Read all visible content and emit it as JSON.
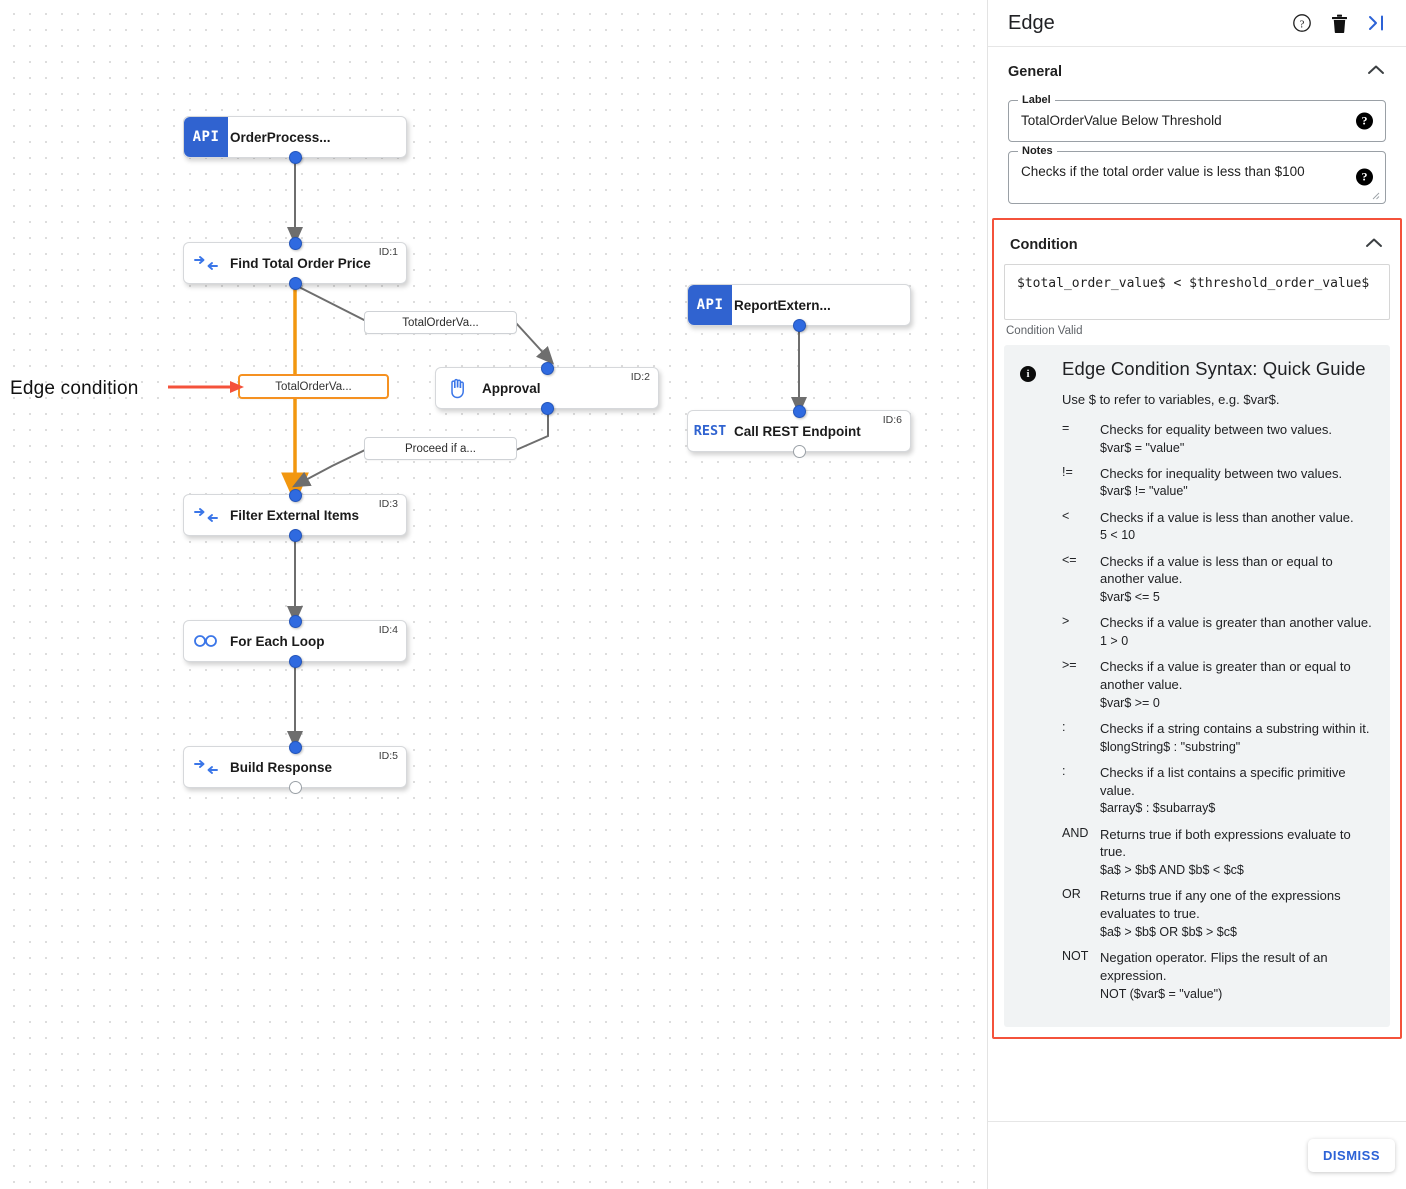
{
  "panel": {
    "title": "Edge",
    "icons": [
      {
        "name": "help-icon",
        "glyph": "?"
      },
      {
        "name": "delete-icon",
        "glyph": "trash"
      },
      {
        "name": "collapse-panel-icon",
        "glyph": ">|"
      }
    ],
    "general": {
      "section_title": "General",
      "label_legend": "Label",
      "label_value": "TotalOrderValue Below Threshold",
      "notes_legend": "Notes",
      "notes_value": "Checks if the total order value is less than $100"
    },
    "condition": {
      "section_title": "Condition",
      "expression": "$total_order_value$ < $threshold_order_value$",
      "status": "Condition Valid",
      "highlight_color": "#f4523b",
      "guide": {
        "title": "Edge Condition Syntax: Quick Guide",
        "intro": "Use $ to refer to variables, e.g. $var$.",
        "operators": [
          {
            "symbol": "=",
            "description": "Checks for equality between two values.",
            "example": "$var$ = \"value\""
          },
          {
            "symbol": "!=",
            "description": "Checks for inequality between two values.",
            "example": "$var$ != \"value\""
          },
          {
            "symbol": "<",
            "description": "Checks if a value is less than another value.",
            "example": "5 < 10"
          },
          {
            "symbol": "<=",
            "description": "Checks if a value is less than or equal to another value.",
            "example": "$var$ <= 5"
          },
          {
            "symbol": ">",
            "description": "Checks if a value is greater than another value.",
            "example": "1 > 0"
          },
          {
            "symbol": ">=",
            "description": "Checks if a value is greater than or equal to another value.",
            "example": "$var$ >= 0"
          },
          {
            "symbol": ":",
            "description": "Checks if a string contains a substring within it.",
            "example": "$longString$ : \"substring\""
          },
          {
            "symbol": ":",
            "description": "Checks if a list contains a specific primitive value.",
            "example": "$array$ : $subarray$"
          },
          {
            "symbol": "AND",
            "description": "Returns true if both expressions evaluate to true.",
            "example": "$a$ > $b$ AND $b$ < $c$"
          },
          {
            "symbol": "OR",
            "description": "Returns true if any one of the expressions evaluates to true.",
            "example": "$a$ > $b$ OR $b$ > $c$"
          },
          {
            "symbol": "NOT",
            "description": "Negation operator. Flips the result of an expression.",
            "example": "NOT ($var$ = \"value\")"
          }
        ]
      }
    },
    "footer": {
      "dismiss_label": "DISMISS"
    }
  },
  "canvas": {
    "annotation": {
      "text": "Edge condition",
      "arrow_color": "#f4523b"
    },
    "accent_edge_color": "#f2970f",
    "nodes": [
      {
        "title": "OrderProcess...",
        "id_label": "",
        "icon": "api-badge",
        "badge": "API"
      },
      {
        "title": "Find Total Order Price",
        "id_label": "ID:1",
        "icon": "converge-arrows-icon"
      },
      {
        "title": "Approval",
        "id_label": "ID:2",
        "icon": "hand-icon"
      },
      {
        "title": "Filter External Items",
        "id_label": "ID:3",
        "icon": "converge-arrows-icon"
      },
      {
        "title": "For Each Loop",
        "id_label": "ID:4",
        "icon": "loop-infinity-icon"
      },
      {
        "title": "Build Response",
        "id_label": "ID:5",
        "icon": "converge-arrows-icon"
      },
      {
        "title": "ReportExtern...",
        "id_label": "",
        "icon": "api-badge",
        "badge": "API"
      },
      {
        "title": "Call REST Endpoint",
        "id_label": "ID:6",
        "icon": "rest-badge",
        "badge": "REST"
      }
    ],
    "edge_labels": [
      {
        "text": "TotalOrderVa...",
        "selected": false
      },
      {
        "text": "TotalOrderVa...",
        "selected": true
      },
      {
        "text": "Proceed if a...",
        "selected": false
      }
    ]
  }
}
